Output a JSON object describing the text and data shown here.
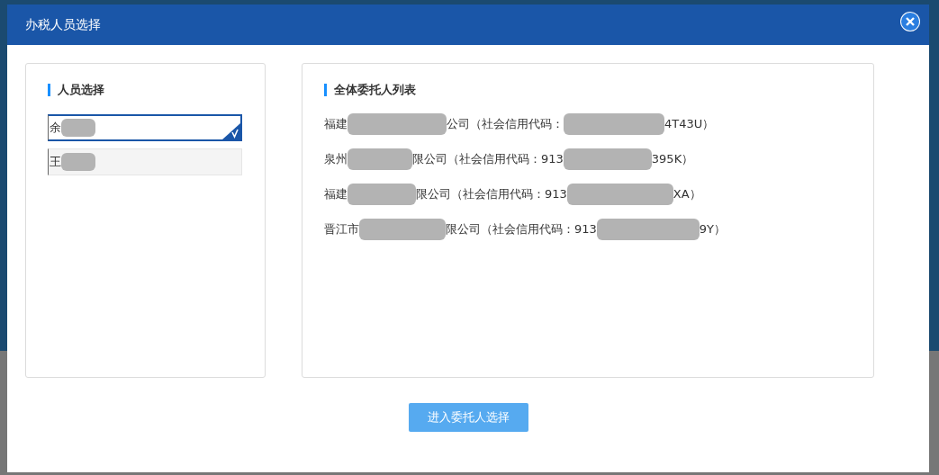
{
  "dialog": {
    "title": "办税人员选择"
  },
  "staff_panel": {
    "heading": "人员选择",
    "people": [
      {
        "name": "余",
        "selected": true
      },
      {
        "name": "王",
        "selected": false
      }
    ]
  },
  "principal_panel": {
    "heading": "全体委托人列表",
    "rows": [
      {
        "parts": [
          "福建",
          "公司（社会信用代码：",
          "4T43U）"
        ]
      },
      {
        "parts": [
          "泉州",
          "限公司（社会信用代码：913",
          "395K）"
        ]
      },
      {
        "parts": [
          "福建",
          "限公司（社会信用代码：913",
          "XA）"
        ]
      },
      {
        "parts": [
          "晋江市",
          "限公司（社会信用代码：913",
          "9Y）"
        ]
      }
    ]
  },
  "confirm_button": "进入委托人选择"
}
